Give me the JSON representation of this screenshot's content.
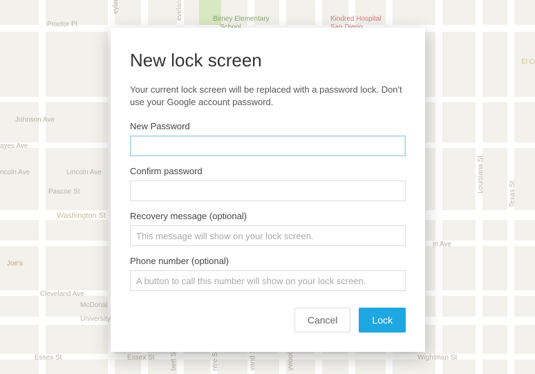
{
  "dialog": {
    "title": "New lock screen",
    "description": "Your current lock screen will be replaced with a password lock. Don't use your Google account password.",
    "fields": {
      "new_password": {
        "label": "New Password",
        "value": "",
        "placeholder": ""
      },
      "confirm_password": {
        "label": "Confirm password",
        "value": "",
        "placeholder": ""
      },
      "recovery_message": {
        "label": "Recovery message (optional)",
        "value": "",
        "placeholder": "This message will show on your lock screen."
      },
      "phone_number": {
        "label": "Phone number (optional)",
        "value": "",
        "placeholder": "A button to call this number will show on your lock screen."
      }
    },
    "buttons": {
      "cancel": "Cancel",
      "lock": "Lock"
    }
  },
  "map": {
    "roads": {
      "johnson_ave": "Johnson Ave",
      "proctor_pl": "Proctor Pl",
      "ayes_ave": "ayes Ave",
      "lincoln_ave_1": "ncoln Ave",
      "lincoln_ave_2": "Lincoln Ave",
      "pascoe_st": "Pascoe St",
      "washington": "Washington St",
      "joes": "Joe's",
      "cleveland_ave": "Cleveland Ave",
      "university": "University",
      "mcdonal": "McDonal",
      "essex_st_1": "Essex St",
      "essex_st_2": "Essex St",
      "bert_st": "bert St",
      "ntre_st": "ntre St",
      "vand_st": "vand St",
      "ywood": "ywood",
      "wightman_st": "Wightman St",
      "in_ave": "in Ave",
      "el_ca": "El Ca",
      "teyland_st": "eyland St",
      "eveland_ave": "eveland Ave",
      "birney": "Birney Elementary",
      "school": "School",
      "kindred": "Kindred Hospital",
      "san_diego": "San Diego",
      "louisiana_st": "Louisiana St",
      "texas_st": "Texas St"
    }
  }
}
